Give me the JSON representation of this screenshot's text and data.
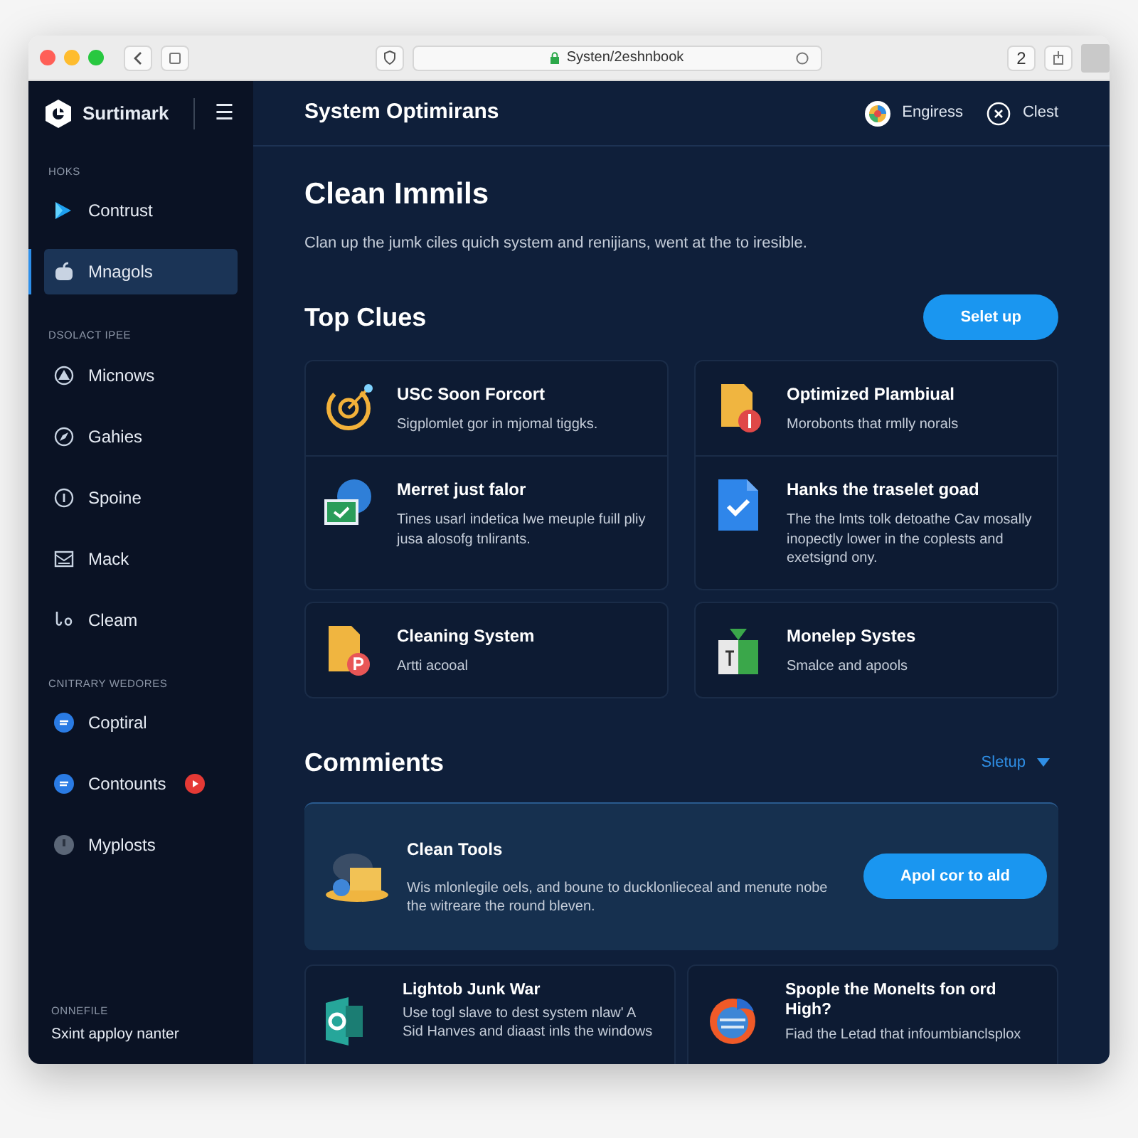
{
  "browser": {
    "url": "Systen/2eshnbook",
    "tab_count": "2"
  },
  "sidebar": {
    "brand": "Surtimark",
    "menu_glyph": "☰",
    "sections": [
      {
        "heading": "HOKS",
        "items": [
          {
            "label": "Contrust",
            "selected": false
          },
          {
            "label": "Mnagols",
            "selected": true
          }
        ]
      },
      {
        "heading": "DSOLACT IPEE",
        "items": [
          {
            "label": "Micnows",
            "selected": false
          },
          {
            "label": "Gahies",
            "selected": false
          },
          {
            "label": "Spoine",
            "selected": false
          },
          {
            "label": "Mack",
            "selected": false
          },
          {
            "label": "Cleam",
            "selected": false
          }
        ]
      },
      {
        "heading": "CNITRARY WEDORES",
        "items": [
          {
            "label": "Coptiral",
            "selected": false
          },
          {
            "label": "Contounts",
            "selected": false,
            "badge": true
          },
          {
            "label": "Myplosts",
            "selected": false
          }
        ]
      }
    ],
    "footer": {
      "caption": "ONNEFILE",
      "text": "Sxint apploy nanter"
    }
  },
  "header": {
    "title": "System Optimirans",
    "actions": [
      {
        "label": "Engiress"
      },
      {
        "label": "Clest"
      }
    ]
  },
  "intro": {
    "title": "Clean Immils",
    "text": "Clan up the jumk ciles quich system and renijians, went at the to iresible."
  },
  "top": {
    "title": "Top Clues",
    "button": "Selet up",
    "cards": [
      {
        "items": [
          {
            "title": "USC Soon Forcort",
            "text": "Sigplomlet gor in mjomal tiggks."
          },
          {
            "title": "Merret just falor",
            "text": "Tines usarl indetica lwe meuple fuill pliy jusa alosofg tnlirants."
          }
        ]
      },
      {
        "items": [
          {
            "title": "Optimized Plambiual",
            "text": "Morobonts that rmlly norals"
          },
          {
            "title": "Hanks the traselet goad",
            "text": "The the lmts tolk detoathe Cav mosally inopectly lower in the coplests and exetsignd ony."
          }
        ]
      },
      {
        "items": [
          {
            "title": "Cleaning System",
            "text": "Artti acooal"
          }
        ]
      },
      {
        "items": [
          {
            "title": "Monelep Systes",
            "text": "Smalce and apools"
          }
        ]
      }
    ]
  },
  "comments": {
    "title": "Commients",
    "filter": "Sletup",
    "feature": {
      "title": "Clean Tools",
      "text": "Wis mlonlegile oels, and boune to ducklonlieceal and menute nobe the witreare the round bleven.",
      "button": "Apol cor to ald"
    },
    "cards": [
      {
        "title": "Lightob Junk War",
        "text": "Use togl slave to dest system nlaw' A Sid Hanves and diaast inls the windows"
      },
      {
        "title": "Spople the Monelts fon ord High?",
        "text": "Fiad the Letad that infoumbianclsplox"
      }
    ]
  }
}
